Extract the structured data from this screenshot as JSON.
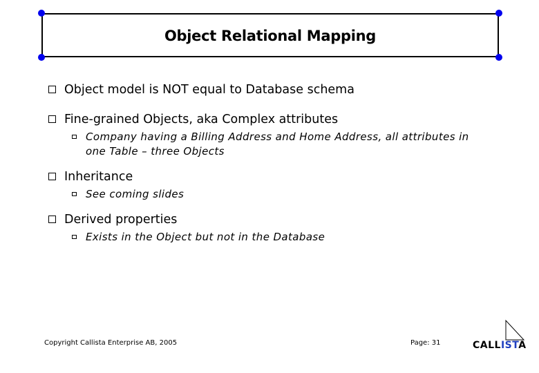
{
  "slide": {
    "title": "Object Relational Mapping",
    "bullets": [
      {
        "text": "Object model is NOT equal to Database schema",
        "sub": []
      },
      {
        "text": "Fine-grained Objects, aka Complex attributes",
        "sub": [
          "Company having a Billing Address and Home Address, all attributes in one Table – three Objects"
        ]
      },
      {
        "text": "Inheritance",
        "sub": [
          "See coming slides"
        ]
      },
      {
        "text": "Derived properties",
        "sub": [
          "Exists in the Object but not in the Database"
        ]
      }
    ]
  },
  "footer": {
    "copyright": "Copyright Callista Enterprise AB, 2005",
    "page_label": "Page: 31"
  },
  "logo": {
    "parts": [
      "CALL",
      "IST",
      "A"
    ],
    "accent_color": "#1f3fbf"
  },
  "colors": {
    "selection_handle": "#0000ee"
  }
}
